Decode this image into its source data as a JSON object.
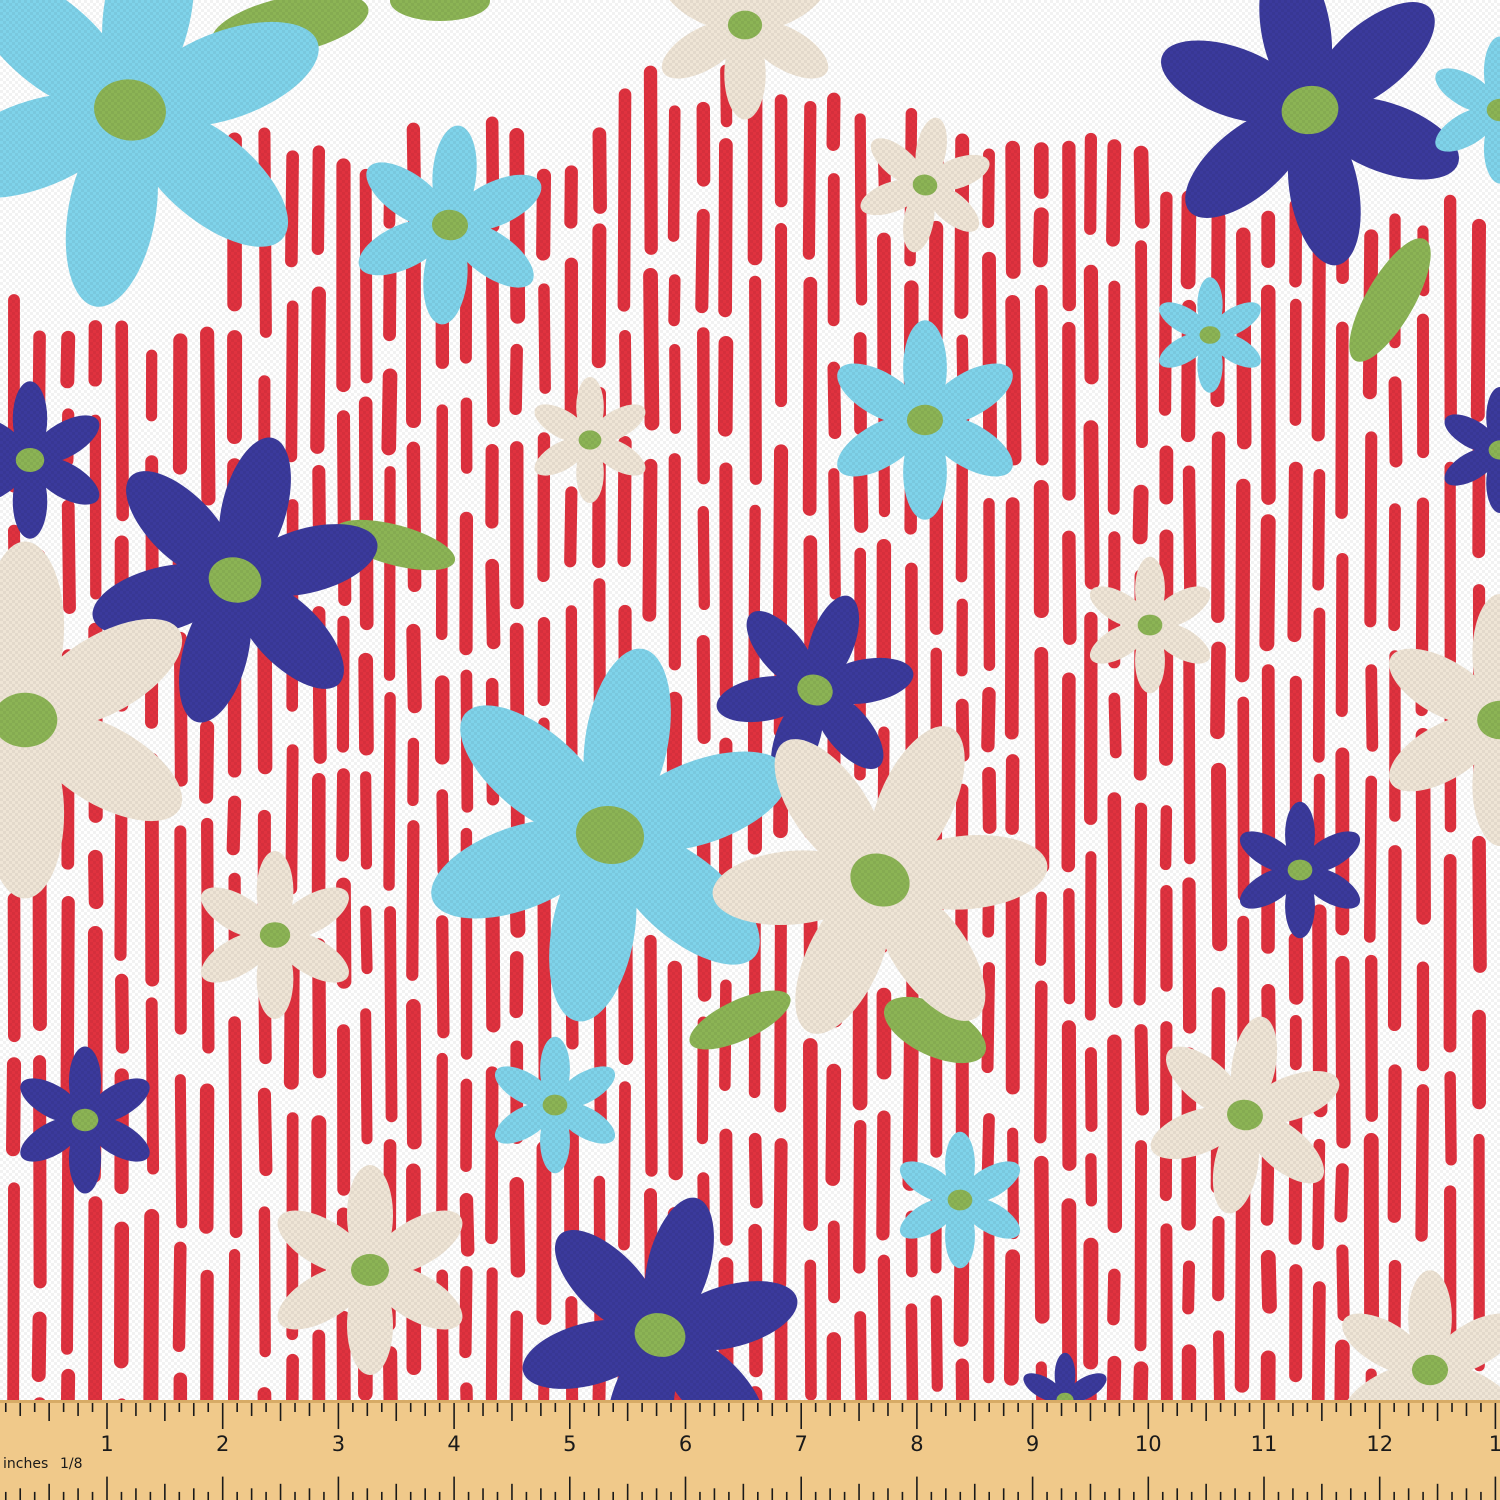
{
  "image": {
    "subject": "fabric-swatch",
    "colors": {
      "background": "#ffffff",
      "stripe": "#e0323f",
      "petal_light_blue": "#7fd3ea",
      "petal_navy": "#3b3a9c",
      "petal_cream": "#efe5d6",
      "flower_center": "#8cb455",
      "leaf": "#8cb455",
      "ruler": "#f0c98a"
    }
  },
  "ruler": {
    "unit_label": "inches",
    "fraction_label": "1/8",
    "numbers": [
      "1",
      "2",
      "3",
      "4",
      "5",
      "6",
      "7",
      "8",
      "9",
      "10",
      "11",
      "12",
      "1"
    ]
  }
}
